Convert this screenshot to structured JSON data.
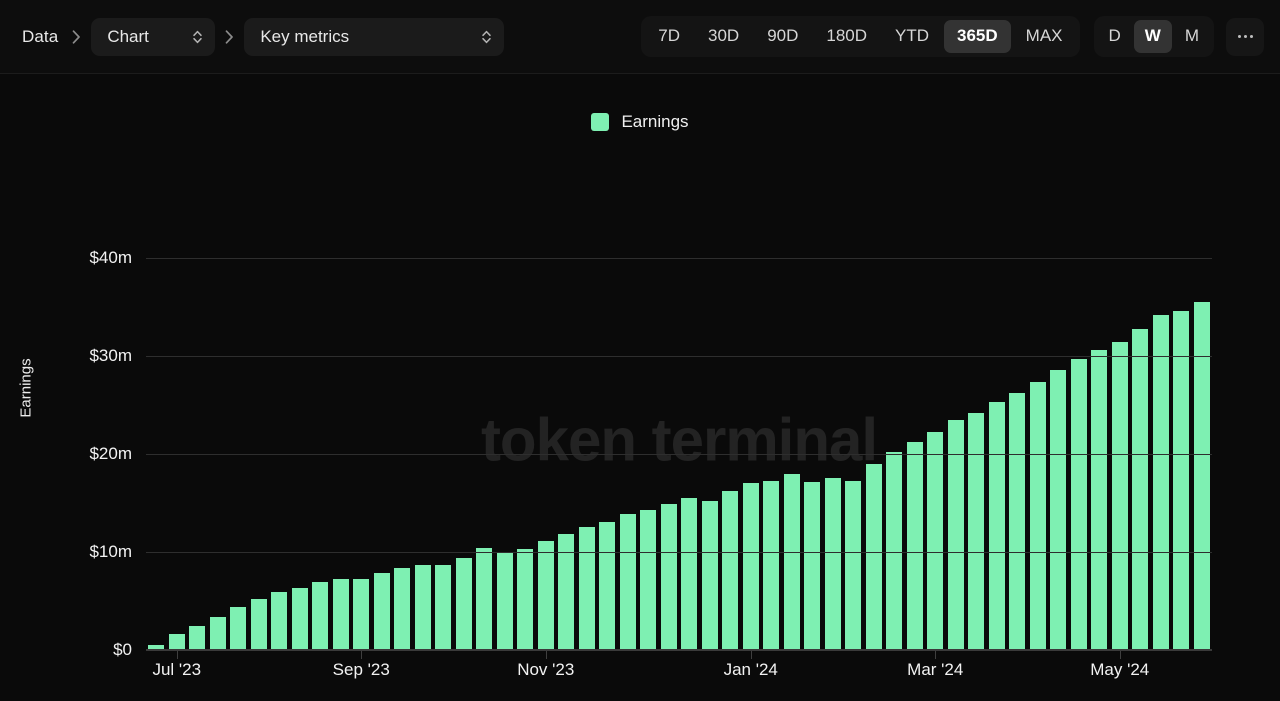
{
  "breadcrumb": {
    "root_label": "Data",
    "separator_icon": "chevron-right-icon",
    "selects": [
      {
        "label": "Chart",
        "icon": "chevron-updown-icon"
      },
      {
        "label": "Key metrics",
        "icon": "chevron-updown-icon"
      }
    ]
  },
  "toolbar": {
    "ranges": [
      {
        "label": "7D",
        "active": false
      },
      {
        "label": "30D",
        "active": false
      },
      {
        "label": "90D",
        "active": false
      },
      {
        "label": "180D",
        "active": false
      },
      {
        "label": "YTD",
        "active": false
      },
      {
        "label": "365D",
        "active": true
      },
      {
        "label": "MAX",
        "active": false
      }
    ],
    "granularity": [
      {
        "label": "D",
        "active": false
      },
      {
        "label": "W",
        "active": true
      },
      {
        "label": "M",
        "active": false
      }
    ],
    "more_label": "⋯",
    "more_icon": "ellipsis-icon"
  },
  "colors": {
    "series": "#7ef0b2",
    "background": "#0a0a0a",
    "grid": "#2e2e2e",
    "active_pill": "#333333"
  },
  "watermark": "token terminal",
  "chart_data": {
    "type": "bar",
    "title": "",
    "xlabel": "",
    "ylabel": "Earnings",
    "ylim": [
      0,
      43
    ],
    "yticks": [
      0,
      10,
      20,
      30,
      40
    ],
    "ytick_labels": [
      "$0",
      "$10m",
      "$20m",
      "$30m",
      "$40m"
    ],
    "grid": true,
    "legend_position": "top-center",
    "legend": [
      "Earnings"
    ],
    "series": [
      {
        "name": "Earnings",
        "color": "#7ef0b2",
        "values": [
          0.5,
          1.6,
          2.5,
          3.4,
          4.4,
          5.2,
          5.9,
          6.3,
          6.9,
          7.3,
          7.3,
          7.9,
          8.4,
          8.7,
          8.7,
          9.4,
          10.4,
          9.9,
          10.3,
          11.1,
          11.9,
          12.6,
          13.1,
          13.9,
          14.3,
          14.9,
          15.5,
          15.2,
          16.2,
          17.1,
          17.3,
          18.0,
          17.2,
          17.6,
          17.3,
          19.0,
          20.2,
          21.2,
          22.3,
          23.5,
          24.2,
          25.3,
          26.2,
          27.4,
          28.6,
          29.7,
          30.6,
          31.5,
          32.8,
          34.2,
          34.6,
          35.5
        ]
      }
    ],
    "x_tick_labels": [
      "Jul '23",
      "Sep '23",
      "Nov '23",
      "Jan '24",
      "Mar '24",
      "May '24"
    ],
    "x_tick_indices": [
      1,
      10,
      19,
      29,
      38,
      47
    ],
    "x_axis_note": "weekly buckets"
  }
}
